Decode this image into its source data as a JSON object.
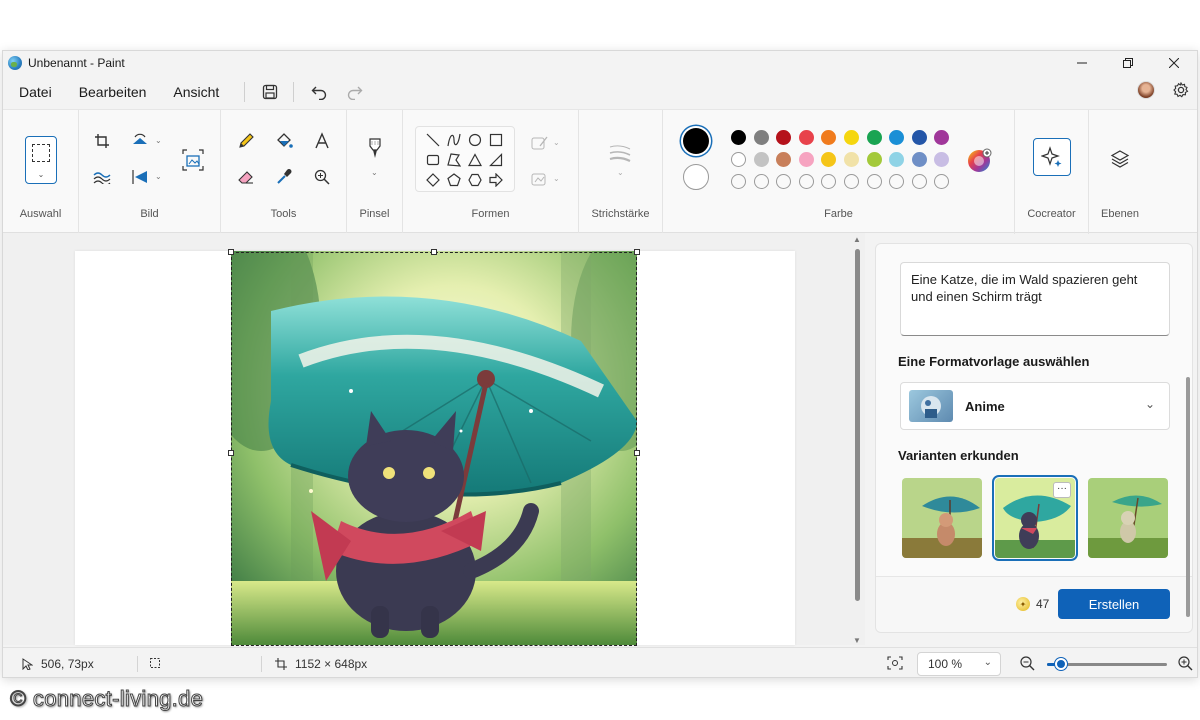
{
  "window": {
    "title": "Unbenannt - Paint",
    "controls": [
      "minimize-icon",
      "restore-icon",
      "close-icon"
    ]
  },
  "menubar": {
    "items": [
      "Datei",
      "Bearbeiten",
      "Ansicht"
    ],
    "icons": [
      "save-icon",
      "undo-icon",
      "redo-icon"
    ],
    "right_icons": [
      "avatar",
      "settings-icon"
    ]
  },
  "ribbon": {
    "groups": {
      "selection": "Auswahl",
      "image": "Bild",
      "tools": "Tools",
      "brush": "Pinsel",
      "shapes": "Formen",
      "stroke": "Strichstärke",
      "color": "Farbe",
      "cocreator": "Cocreator",
      "layers": "Ebenen"
    },
    "colors": {
      "primary": "#000000",
      "secondary": "#ffffff",
      "row1": [
        "#000000",
        "#7f7f7f",
        "#b5121b",
        "#e8424b",
        "#f07b1d",
        "#f5d60f",
        "#1aa452",
        "#1a8fd6",
        "#2456a8",
        "#a0379a"
      ],
      "row2": [
        "#ffffff",
        "#c3c3c3",
        "#c87f5a",
        "#f6a3c0",
        "#f5c518",
        "#f1e2a8",
        "#a3c93a",
        "#8fd3e6",
        "#6f8fc6",
        "#c8bde4"
      ],
      "row3_empty_count": 10
    }
  },
  "canvas": {
    "background": "#ffffff",
    "image_description": "anime-style cat with teal umbrella in forest"
  },
  "cocreator": {
    "prompt": "Eine Katze, die im Wald spazieren geht und einen Schirm trägt",
    "style_heading": "Eine Formatvorlage auswählen",
    "style_value": "Anime",
    "variants_heading": "Varianten erkunden",
    "variants_more": "···",
    "credits": "47",
    "create_label": "Erstellen"
  },
  "statusbar": {
    "cursor_position": "506, 73px",
    "canvas_size": "1152 × 648px",
    "zoom": "100 %",
    "zoom_level": 0.12
  },
  "watermark": "© connect-living.de"
}
